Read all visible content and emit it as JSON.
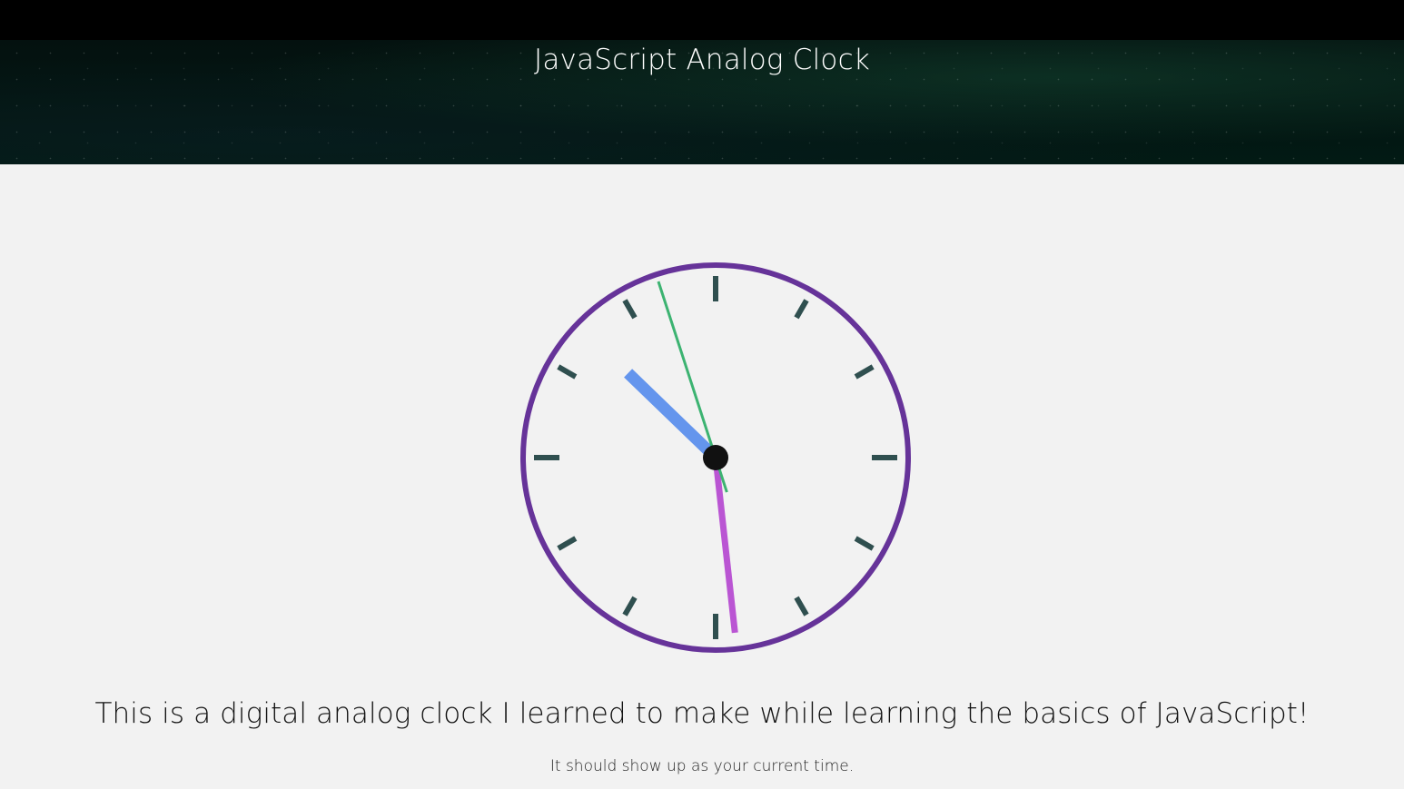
{
  "header": {
    "title": "JavaScript Analog Clock"
  },
  "clock": {
    "time": {
      "hours": 10,
      "minutes": 28,
      "seconds": 57
    },
    "colors": {
      "rim": "#663399",
      "ticks": "#2f4f4f",
      "hour_hand": "#6495ed",
      "minute_hand": "#ba55d3",
      "second_hand": "#3cb371",
      "center_dot": "#111111",
      "face": "#f2f2f2"
    }
  },
  "content": {
    "tagline": "This is a digital analog clock I learned to make while learning the basics of JavaScript!",
    "subline": "It should show up as your current time."
  }
}
